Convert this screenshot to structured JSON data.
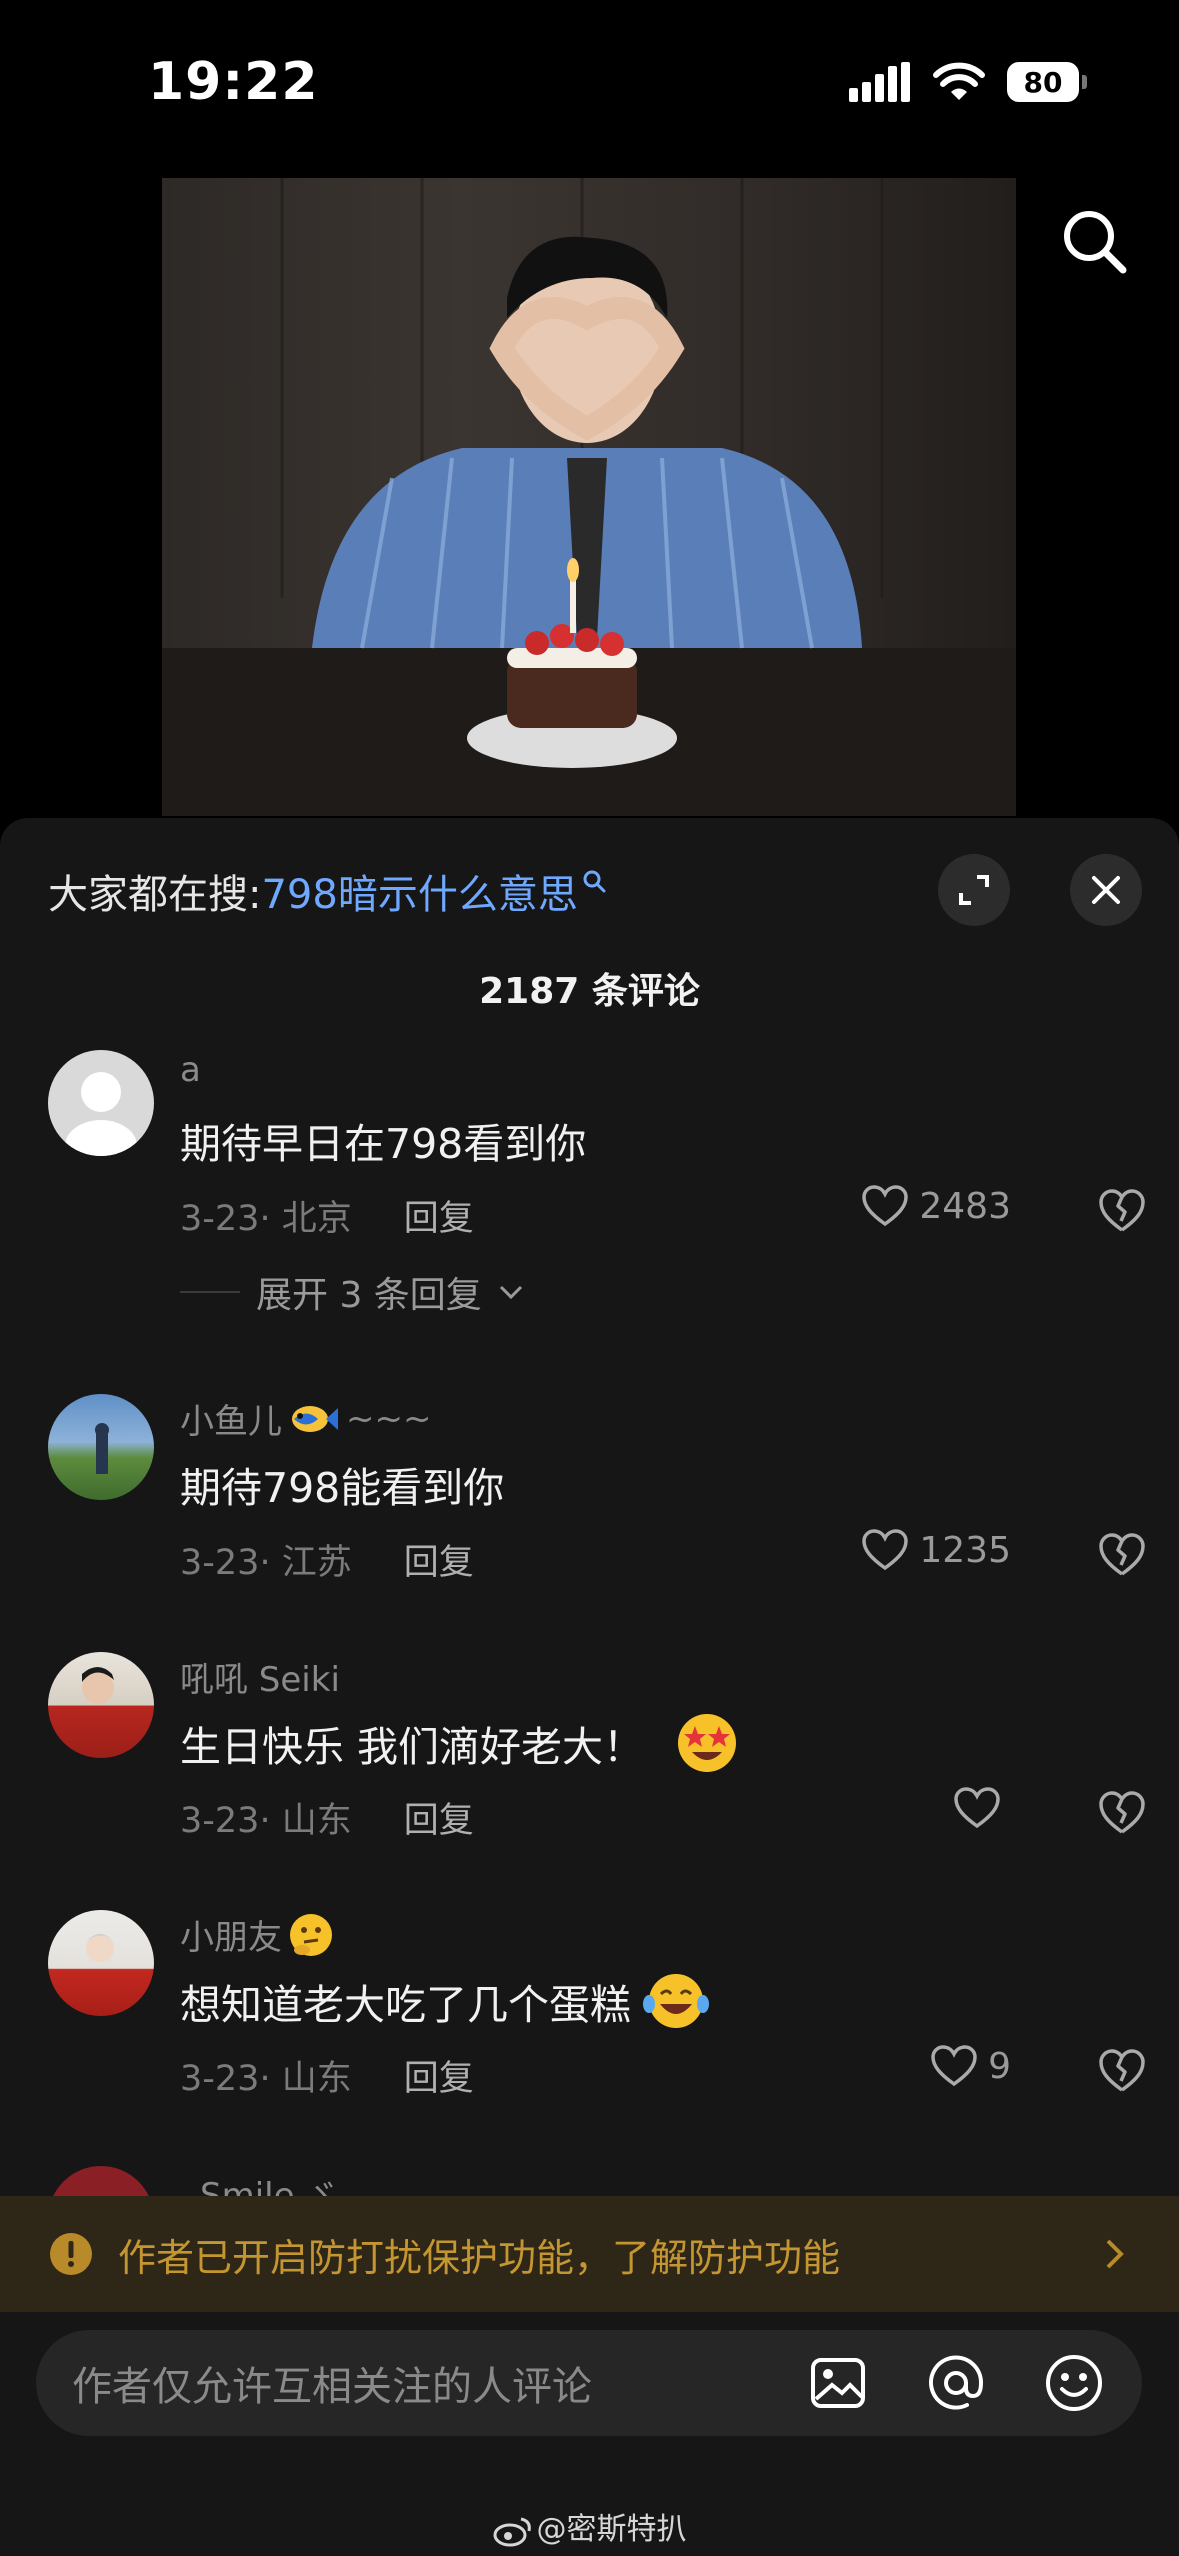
{
  "status": {
    "time": "19:22",
    "battery": "80"
  },
  "hot_search": {
    "prefix": "大家都在搜:",
    "query": "798暗示什么意思"
  },
  "comment_count": "2187 条评论",
  "comments": [
    {
      "user": "a",
      "text": "期待早日在798看到你",
      "date": "3-23",
      "location": "北京",
      "reply": "回复",
      "likes": "2483",
      "expand": "展开 3 条回复"
    },
    {
      "user": "小鱼儿",
      "user_suffix": "~~~",
      "text": "期待798能看到你",
      "date": "3-23",
      "location": "江苏",
      "reply": "回复",
      "likes": "1235"
    },
    {
      "user": "吼吼 Seiki",
      "text": "生日快乐 我们滴好老大！",
      "date": "3-23",
      "location": "山东",
      "reply": "回复",
      "likes": ""
    },
    {
      "user": "小朋友",
      "text": "想知道老大吃了几个蛋糕",
      "date": "3-23",
      "location": "山东",
      "reply": "回复",
      "likes": "9"
    },
    {
      "user": "Smile ゞ"
    }
  ],
  "notice": {
    "text": "作者已开启防打扰保护功能，了解防护功能"
  },
  "input": {
    "placeholder": "作者仅允许互相关注的人评论"
  },
  "watermark": "@密斯特扒",
  "colors": {
    "accent_link": "#6fa8ff",
    "notice_text": "#c49632",
    "notice_bg": "#2e2616",
    "sheet_bg": "#161616"
  }
}
